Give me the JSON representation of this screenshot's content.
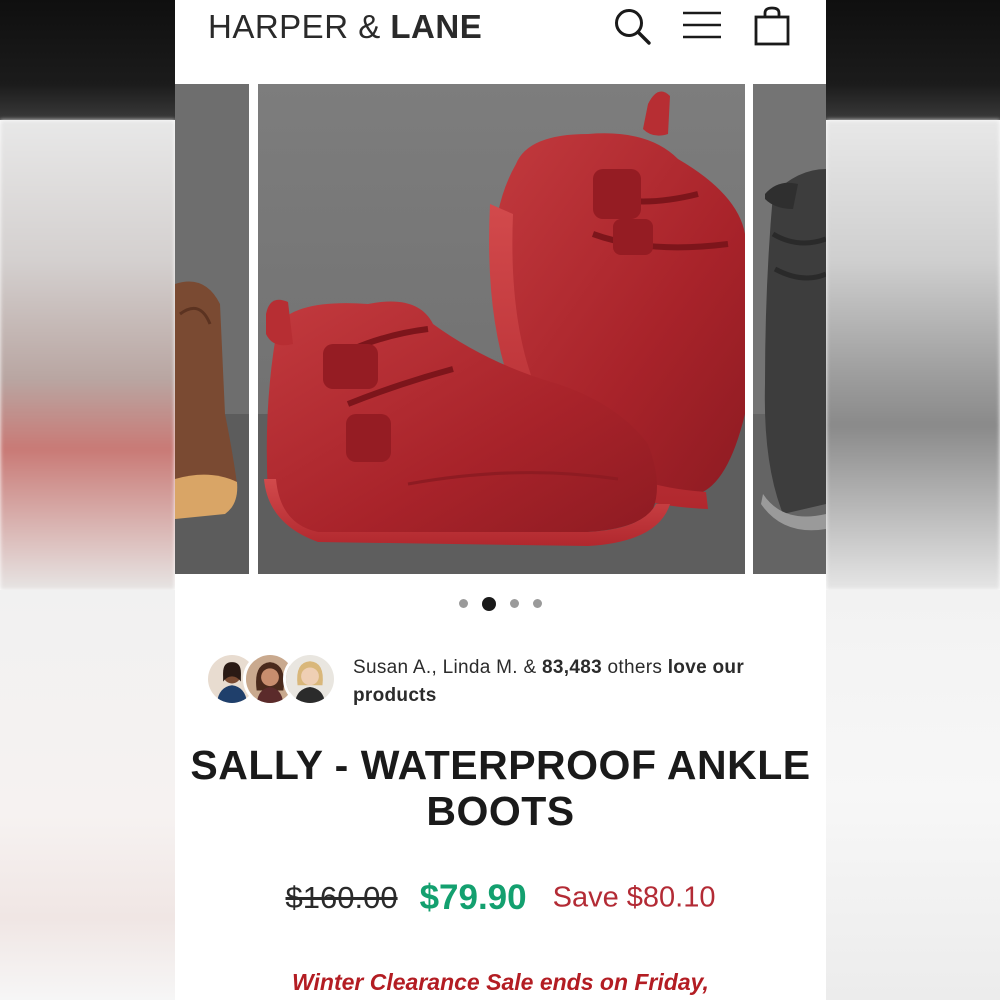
{
  "brand": {
    "name_light": "HARPER & ",
    "name_bold": "LANE"
  },
  "header": {
    "icons": [
      "search-icon",
      "menu-icon",
      "cart-icon"
    ]
  },
  "carousel": {
    "slide_count": 4,
    "active_index": 1
  },
  "social_proof": {
    "names": "Susan A., Linda M. & ",
    "count": "83,483",
    "others": " others ",
    "love": "love our products"
  },
  "product": {
    "title": "SALLY - WATERPROOF ANKLE BOOTS",
    "original_price": "$160.00",
    "sale_price": "$79.90",
    "savings": "Save $80.10"
  },
  "promo": {
    "text": "Winter Clearance Sale ends on Friday,"
  },
  "colors": {
    "sale_price": "#13a06f",
    "savings": "#b32b35",
    "promo": "#b31d23"
  }
}
